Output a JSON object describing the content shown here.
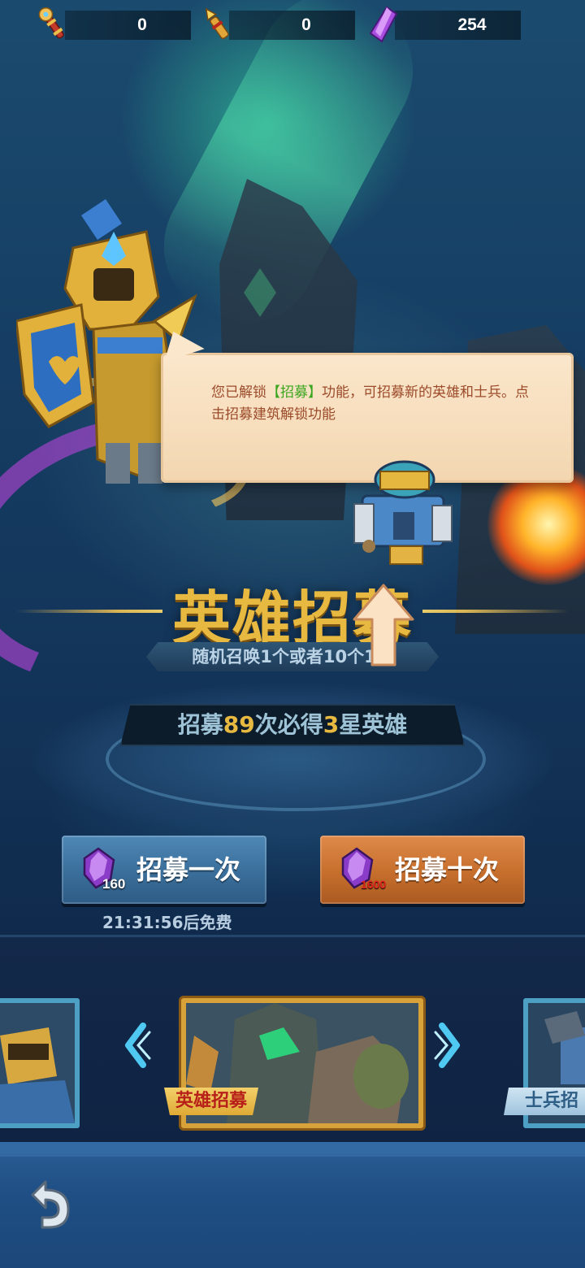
{
  "resources": [
    {
      "icon": "torch-scroll-icon",
      "value": "0"
    },
    {
      "icon": "golden-scroll-icon",
      "value": "0"
    },
    {
      "icon": "purple-gem-icon",
      "value": "254"
    }
  ],
  "dialog": {
    "text_before": "您已解锁",
    "highlight": "【招募】",
    "text_after": "功能，可招募新的英雄和士兵。点击招募建筑解锁功能"
  },
  "banner": {
    "title": "英雄招募",
    "subtitle": "随机召唤1个或者10个1星",
    "pity_prefix": "招募",
    "pity_count": "89",
    "pity_middle": "次必得",
    "pity_star": "3",
    "pity_suffix": "星英雄"
  },
  "buttons": {
    "single": {
      "label": "招募一次",
      "cost": "160"
    },
    "ten": {
      "label": "招募十次",
      "cost": "1600"
    }
  },
  "free_timer": "21:31:56后免费",
  "cards": {
    "main_tag": "英雄招募",
    "right_tag": "士兵招"
  },
  "colors": {
    "gold": "#e8b940",
    "gem_purple": "#9b3fd0",
    "dialog_text": "#9b4a2a",
    "highlight_green": "#3aa51f",
    "button_blue": "#3a6e9a",
    "button_orange": "#c66e2c",
    "cost_red": "#e0241c"
  }
}
